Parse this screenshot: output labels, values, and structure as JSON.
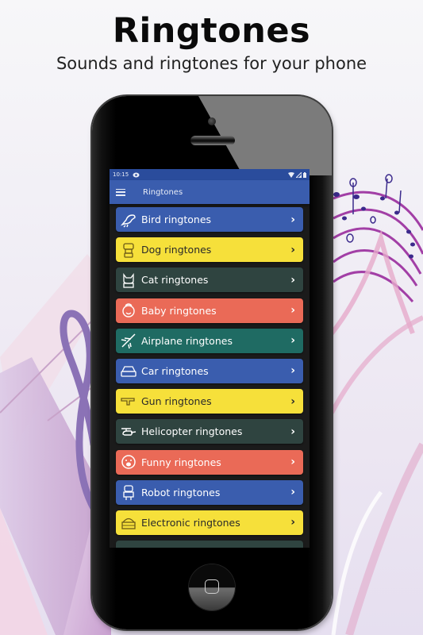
{
  "promo": {
    "title": "Ringtones",
    "subtitle": "Sounds and ringtones for your phone"
  },
  "statusbar": {
    "time": "10:15",
    "icons": [
      "eye-icon",
      "wifi-icon",
      "signal-icon",
      "battery-icon"
    ]
  },
  "appbar": {
    "menu_icon": "hamburger-menu-icon",
    "title": "Ringtones"
  },
  "list": {
    "items": [
      {
        "label": "Bird ringtones",
        "icon": "bird-icon",
        "color": "#3a5dae",
        "text_color": "#ffffff"
      },
      {
        "label": "Dog ringtones",
        "icon": "dog-icon",
        "color": "#f6e03a",
        "text_color": "#2a2a2a"
      },
      {
        "label": "Cat ringtones",
        "icon": "cat-icon",
        "color": "#2f4440",
        "text_color": "#ffffff"
      },
      {
        "label": "Baby ringtones",
        "icon": "baby-icon",
        "color": "#ea6a57",
        "text_color": "#ffffff"
      },
      {
        "label": "Airplane ringtones",
        "icon": "airplane-icon",
        "color": "#1f6b63",
        "text_color": "#ffffff"
      },
      {
        "label": "Car ringtones",
        "icon": "car-icon",
        "color": "#3a5dae",
        "text_color": "#ffffff"
      },
      {
        "label": "Gun ringtones",
        "icon": "gun-icon",
        "color": "#f6e03a",
        "text_color": "#2a2a2a"
      },
      {
        "label": "Helicopter ringtones",
        "icon": "helicopter-icon",
        "color": "#2f4440",
        "text_color": "#ffffff"
      },
      {
        "label": "Funny ringtones",
        "icon": "funny-face-icon",
        "color": "#ea6a57",
        "text_color": "#ffffff"
      },
      {
        "label": "Robot ringtones",
        "icon": "robot-icon",
        "color": "#3a5dae",
        "text_color": "#ffffff"
      },
      {
        "label": "Electronic ringtones",
        "icon": "electronic-icon",
        "color": "#f6e03a",
        "text_color": "#2a2a2a"
      },
      {
        "label": "",
        "icon": "partial-icon",
        "color": "#2f4440",
        "text_color": "#ffffff"
      }
    ],
    "chevron": "›"
  },
  "colors": {
    "statusbar": "#2a4c9c",
    "appbar": "#3a5dae",
    "screen_bg": "#1b1b1b"
  }
}
